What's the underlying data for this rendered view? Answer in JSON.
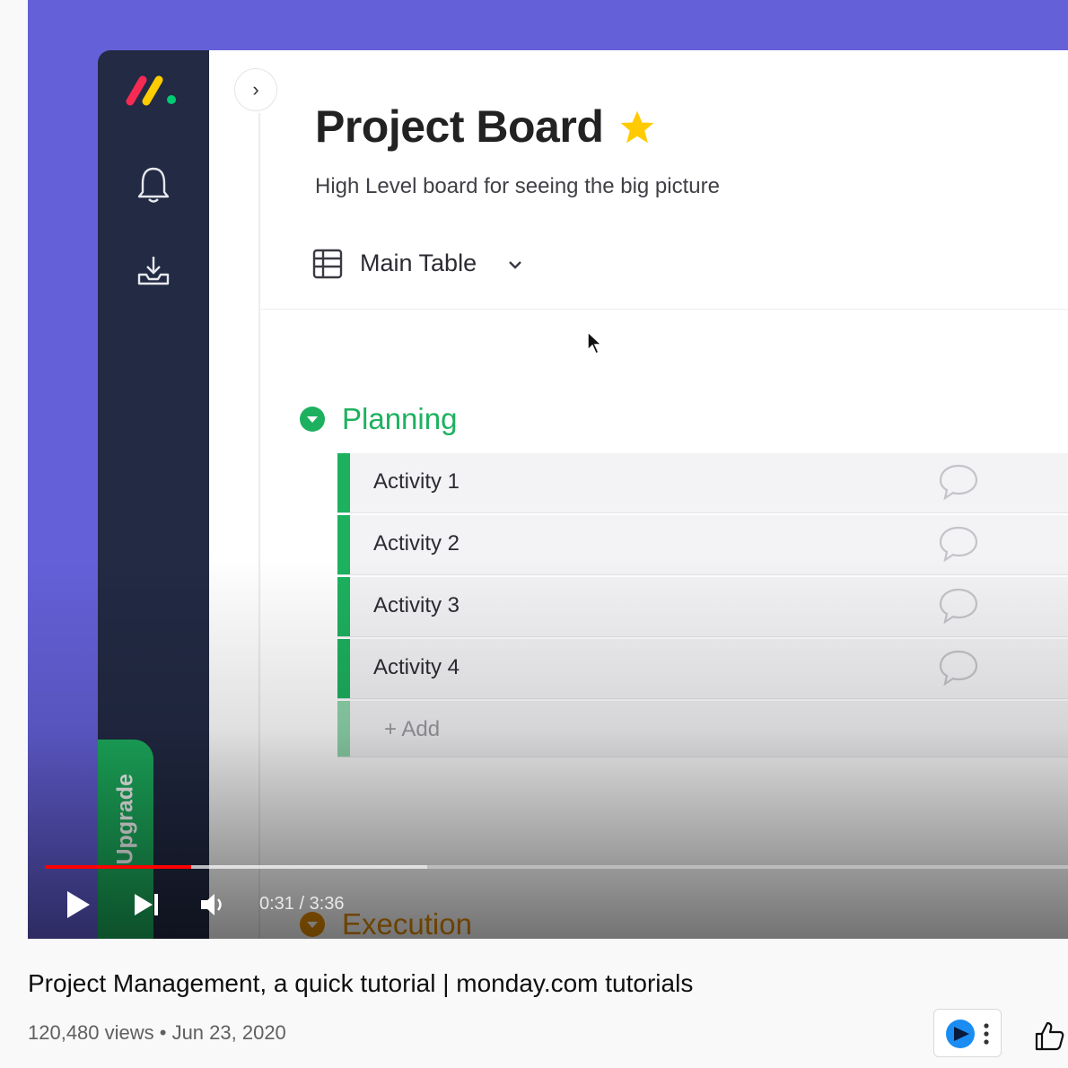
{
  "video": {
    "board": {
      "title": "Project Board",
      "description": "High Level board for seeing the big picture",
      "view": {
        "label": "Main Table"
      },
      "groups": [
        {
          "name": "Planning",
          "color": "#1db15f",
          "rows": [
            {
              "label": "Activity 1"
            },
            {
              "label": "Activity 2"
            },
            {
              "label": "Activity 3"
            },
            {
              "label": "Activity 4"
            }
          ],
          "add_label": "+ Add"
        },
        {
          "name": "Execution",
          "color": "#e08a00"
        }
      ]
    },
    "sidebar": {
      "upgrade_label": "Upgrade",
      "icons": [
        "monday-logo-icon",
        "bell-icon",
        "inbox-download-icon"
      ]
    },
    "player": {
      "time": "0:31 / 3:36",
      "played_fraction": 0.143,
      "buffered_fraction": 0.374,
      "accent": "#ff0000"
    }
  },
  "info": {
    "title": "Project Management, a quick tutorial | monday.com tutorials",
    "meta": "120,480 views • Jun 23, 2020"
  },
  "colors": {
    "background": "#6460d8",
    "sidebar": "#222a44",
    "green": "#1db15f"
  }
}
